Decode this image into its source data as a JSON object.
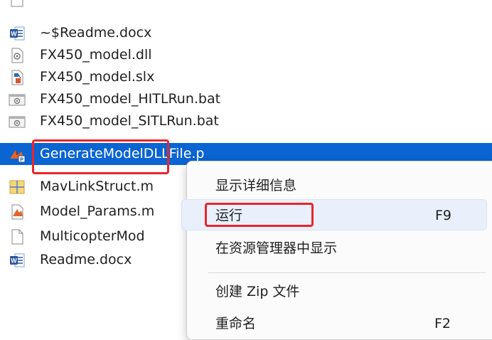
{
  "files": [
    {
      "name": "~$Readme.docx",
      "icon": "word-doc-icon"
    },
    {
      "name": "FX450_model.dll",
      "icon": "dll-file-icon"
    },
    {
      "name": "FX450_model.slx",
      "icon": "simulink-model-icon"
    },
    {
      "name": "FX450_model_HITLRun.bat",
      "icon": "batch-file-icon"
    },
    {
      "name": "FX450_model_SITLRun.bat",
      "icon": "batch-file-icon"
    },
    {
      "name": "GenerateModelDLLFile.p",
      "icon": "matlab-p-file-icon"
    },
    {
      "name": "MavLinkStruct.m",
      "icon": "matlab-data-icon"
    },
    {
      "name": "Model_Params.m",
      "icon": "matlab-script-icon"
    },
    {
      "name": "MulticopterMod",
      "icon": "generic-file-icon"
    },
    {
      "name": "Readme.docx",
      "icon": "word-doc-icon"
    }
  ],
  "context_menu": {
    "items": [
      {
        "label": "显示详细信息",
        "shortcut": ""
      },
      {
        "label": "运行",
        "shortcut": "F9"
      },
      {
        "label": "在资源管理器中显示",
        "shortcut": ""
      },
      {
        "label": "创建 Zip 文件",
        "shortcut": ""
      },
      {
        "label": "重命名",
        "shortcut": "F2"
      }
    ]
  },
  "colors": {
    "selection": "#0a64d2",
    "highlight_box": "#e8262b",
    "menu_hover": "#e9f0fb"
  }
}
